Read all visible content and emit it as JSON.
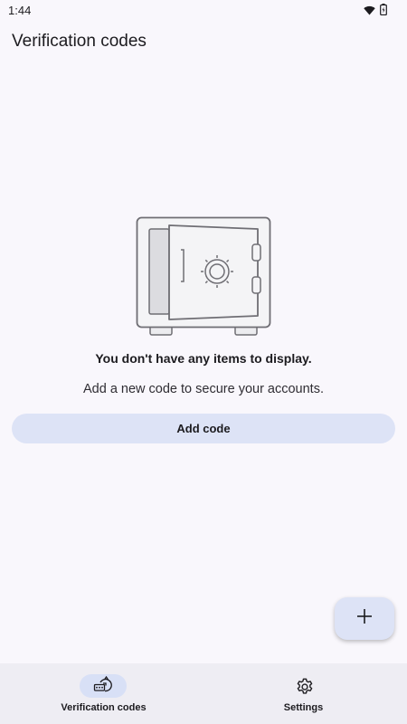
{
  "status_bar": {
    "time": "1:44"
  },
  "header": {
    "title": "Verification codes"
  },
  "empty_state": {
    "heading": "You don't have any items to display.",
    "subtext": "Add a new code to secure your accounts.",
    "add_button_label": "Add code",
    "illustration": "vault-icon"
  },
  "fab": {
    "icon": "plus-icon"
  },
  "bottom_nav": {
    "items": [
      {
        "label": "Verification codes",
        "icon": "authenticator-icon",
        "selected": true
      },
      {
        "label": "Settings",
        "icon": "gear-icon",
        "selected": false
      }
    ]
  },
  "colors": {
    "background": "#f9f7fc",
    "accent_container": "#dde3f6",
    "nav_background": "#eeedf3"
  }
}
